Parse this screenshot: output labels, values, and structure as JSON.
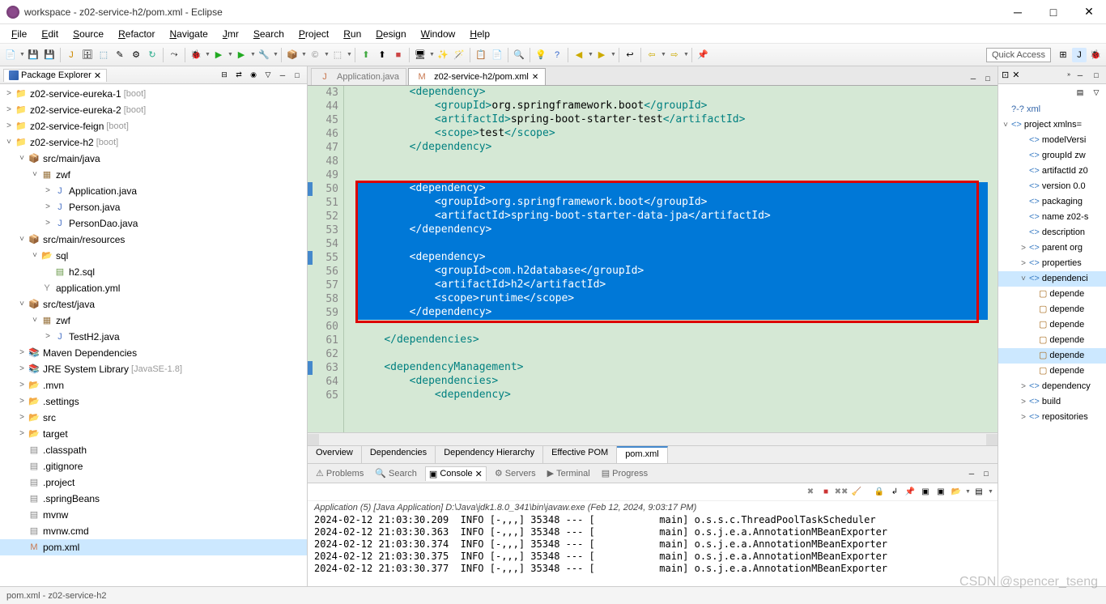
{
  "title": "workspace - z02-service-h2/pom.xml - Eclipse",
  "menu": [
    "File",
    "Edit",
    "Source",
    "Refactor",
    "Navigate",
    "Jmr",
    "Search",
    "Project",
    "Run",
    "Design",
    "Window",
    "Help"
  ],
  "quickAccess": "Quick Access",
  "packageExplorer": {
    "title": "Package Explorer",
    "projects": [
      {
        "name": "z02-service-eureka-1",
        "decor": "[boot]",
        "expanded": false
      },
      {
        "name": "z02-service-eureka-2",
        "decor": "[boot]",
        "expanded": false
      },
      {
        "name": "z02-service-feign",
        "decor": "[boot]",
        "expanded": false
      },
      {
        "name": "z02-service-h2",
        "decor": "[boot]",
        "expanded": true
      }
    ],
    "h2children": {
      "srcMainJava": "src/main/java",
      "zwf": "zwf",
      "appJava": "Application.java",
      "personJava": "Person.java",
      "personDaoJava": "PersonDao.java",
      "srcMainRes": "src/main/resources",
      "sql": "sql",
      "h2sql": "h2.sql",
      "appYml": "application.yml",
      "srcTestJava": "src/test/java",
      "zwf2": "zwf",
      "testH2": "TestH2.java",
      "mavenDeps": "Maven Dependencies",
      "jre": "JRE System Library",
      "jreDecor": "[JavaSE-1.8]",
      "mvn": ".mvn",
      "settings": ".settings",
      "src": "src",
      "target": "target",
      "classpath": ".classpath",
      "gitignore": ".gitignore",
      "project": ".project",
      "springBeans": ".springBeans",
      "mvnw": "mvnw",
      "mvnwCmd": "mvnw.cmd",
      "pomxml": "pom.xml"
    }
  },
  "editorTabs": [
    {
      "label": "Application.java",
      "active": false
    },
    {
      "label": "z02-service-h2/pom.xml",
      "active": true
    }
  ],
  "code": {
    "startLine": 43,
    "lines": [
      {
        "n": 43,
        "sel": false,
        "html": "        <span class='tag'>&lt;dependency&gt;</span>"
      },
      {
        "n": 44,
        "sel": false,
        "html": "            <span class='tag'>&lt;groupId&gt;</span><span class='txt'>org.springframework.boot</span><span class='tag'>&lt;/groupId&gt;</span>"
      },
      {
        "n": 45,
        "sel": false,
        "html": "            <span class='tag'>&lt;artifactId&gt;</span><span class='txt'>spring-boot-starter-test</span><span class='tag'>&lt;/artifactId&gt;</span>"
      },
      {
        "n": 46,
        "sel": false,
        "html": "            <span class='tag'>&lt;scope&gt;</span><span class='txt'>test</span><span class='tag'>&lt;/scope&gt;</span>"
      },
      {
        "n": 47,
        "sel": false,
        "html": "        <span class='tag'>&lt;/dependency&gt;</span>"
      },
      {
        "n": 48,
        "sel": false,
        "html": ""
      },
      {
        "n": 49,
        "sel": false,
        "html": ""
      },
      {
        "n": 50,
        "sel": true,
        "html": "        <span class='tag'>&lt;dependency&gt;</span>"
      },
      {
        "n": 51,
        "sel": true,
        "html": "            <span class='tag'>&lt;groupId&gt;</span><span class='txt'>org.springframework.boot</span><span class='tag'>&lt;/groupId&gt;</span>"
      },
      {
        "n": 52,
        "sel": true,
        "html": "            <span class='tag'>&lt;artifactId&gt;</span><span class='txt'>spring-boot-starter-data-jpa</span><span class='tag'>&lt;/artifactId&gt;</span>"
      },
      {
        "n": 53,
        "sel": true,
        "html": "        <span class='tag'>&lt;/dependency&gt;</span>"
      },
      {
        "n": 54,
        "sel": true,
        "html": ""
      },
      {
        "n": 55,
        "sel": true,
        "html": "        <span class='tag'>&lt;dependency&gt;</span>"
      },
      {
        "n": 56,
        "sel": true,
        "html": "            <span class='tag'>&lt;groupId&gt;</span><span class='txt'>com.h2database</span><span class='tag'>&lt;/groupId&gt;</span>"
      },
      {
        "n": 57,
        "sel": true,
        "html": "            <span class='tag'>&lt;artifactId&gt;</span><span class='txt'>h2</span><span class='tag'>&lt;/artifactId&gt;</span>"
      },
      {
        "n": 58,
        "sel": true,
        "html": "            <span class='tag'>&lt;scope&gt;</span><span class='txt'>runtime</span><span class='tag'>&lt;/scope&gt;</span>"
      },
      {
        "n": 59,
        "sel": true,
        "html": "        <span class='tag'>&lt;/dependency&gt;</span>"
      },
      {
        "n": 60,
        "sel": false,
        "html": ""
      },
      {
        "n": 61,
        "sel": false,
        "html": "    <span class='tag'>&lt;/dependencies&gt;</span>"
      },
      {
        "n": 62,
        "sel": false,
        "html": ""
      },
      {
        "n": 63,
        "sel": false,
        "html": "    <span class='tag'>&lt;dependencyManagement&gt;</span>"
      },
      {
        "n": 64,
        "sel": false,
        "html": "        <span class='tag'>&lt;dependencies&gt;</span>"
      },
      {
        "n": 65,
        "sel": false,
        "html": "            <span class='tag'>&lt;dependency&gt;</span>"
      }
    ]
  },
  "subTabs": [
    "Overview",
    "Dependencies",
    "Dependency Hierarchy",
    "Effective POM",
    "pom.xml"
  ],
  "activeSubTab": "pom.xml",
  "bottomTabs": [
    {
      "label": "Problems",
      "icon": "⚠"
    },
    {
      "label": "Search",
      "icon": "🔍"
    },
    {
      "label": "Console",
      "icon": "▣",
      "active": true
    },
    {
      "label": "Servers",
      "icon": "⚙"
    },
    {
      "label": "Terminal",
      "icon": "▶"
    },
    {
      "label": "Progress",
      "icon": "▤"
    }
  ],
  "consoleTitle": "Application (5) [Java Application] D:\\Java\\jdk1.8.0_341\\bin\\javaw.exe (Feb 12, 2024, 9:03:17 PM)",
  "consoleLines": [
    "2024-02-12 21:03:30.209  INFO [-,,,] 35348 --- [           main] o.s.s.c.ThreadPoolTaskScheduler",
    "2024-02-12 21:03:30.363  INFO [-,,,] 35348 --- [           main] o.s.j.e.a.AnnotationMBeanExporter",
    "2024-02-12 21:03:30.374  INFO [-,,,] 35348 --- [           main] o.s.j.e.a.AnnotationMBeanExporter",
    "2024-02-12 21:03:30.375  INFO [-,,,] 35348 --- [           main] o.s.j.e.a.AnnotationMBeanExporter",
    "2024-02-12 21:03:30.377  INFO [-,,,] 35348 --- [           main] o.s.j.e.a.AnnotationMBeanExporter"
  ],
  "outline": {
    "header": "xml",
    "xmlLabel": "?-? xml",
    "proj": "project xmlns=",
    "nodes": [
      {
        "t": "modelVersi",
        "k": "el"
      },
      {
        "t": "groupId  zw",
        "k": "el"
      },
      {
        "t": "artifactId  z0",
        "k": "el"
      },
      {
        "t": "version  0.0",
        "k": "el"
      },
      {
        "t": "packaging",
        "k": "el"
      },
      {
        "t": "name  z02-s",
        "k": "el"
      },
      {
        "t": "description",
        "k": "el"
      },
      {
        "t": "parent  org",
        "k": "el",
        "exp": true
      },
      {
        "t": "properties",
        "k": "el",
        "exp": true
      },
      {
        "t": "dependenci",
        "k": "el",
        "exp": false,
        "sel": true
      },
      {
        "t": "depende",
        "k": "sub"
      },
      {
        "t": "depende",
        "k": "sub"
      },
      {
        "t": "depende",
        "k": "sub"
      },
      {
        "t": "depende",
        "k": "sub"
      },
      {
        "t": "depende",
        "k": "sub",
        "sel2": true
      },
      {
        "t": "depende",
        "k": "sub"
      },
      {
        "t": "dependency",
        "k": "el",
        "exp": true
      },
      {
        "t": "build",
        "k": "el",
        "exp": true
      },
      {
        "t": "repositories",
        "k": "el",
        "exp": true
      }
    ]
  },
  "statusBar": "pom.xml - z02-service-h2",
  "watermark": "CSDN @spencer_tseng"
}
